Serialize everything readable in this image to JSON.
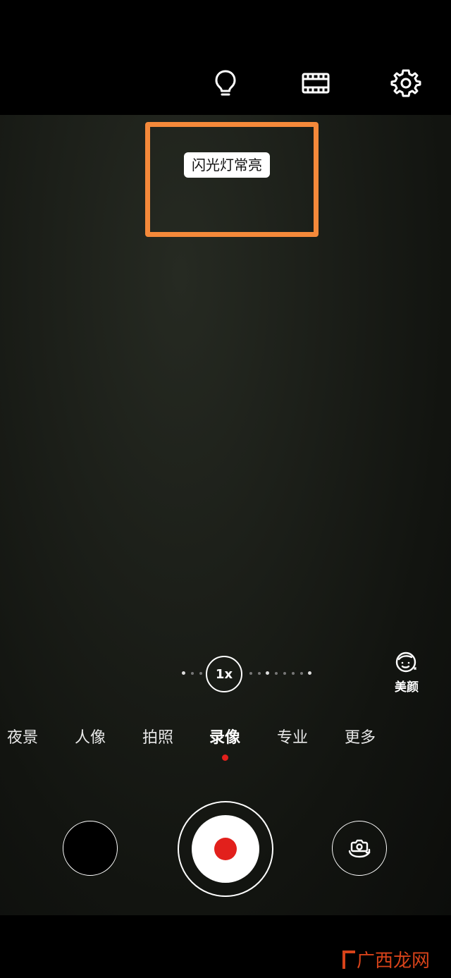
{
  "top_bar": {
    "icons": [
      "lightbulb-icon",
      "film-icon",
      "gear-icon"
    ]
  },
  "viewfinder": {
    "toast_text": "闪光灯常亮",
    "highlight_color": "#f5893a"
  },
  "zoom": {
    "label": "1x"
  },
  "beauty": {
    "label": "美颜"
  },
  "modes": {
    "items": [
      "夜景",
      "人像",
      "拍照",
      "录像",
      "专业",
      "更多"
    ],
    "active": "录像"
  },
  "colors": {
    "record_red": "#e2201c",
    "background": "#000000"
  },
  "watermark": {
    "text": "广西龙网"
  }
}
